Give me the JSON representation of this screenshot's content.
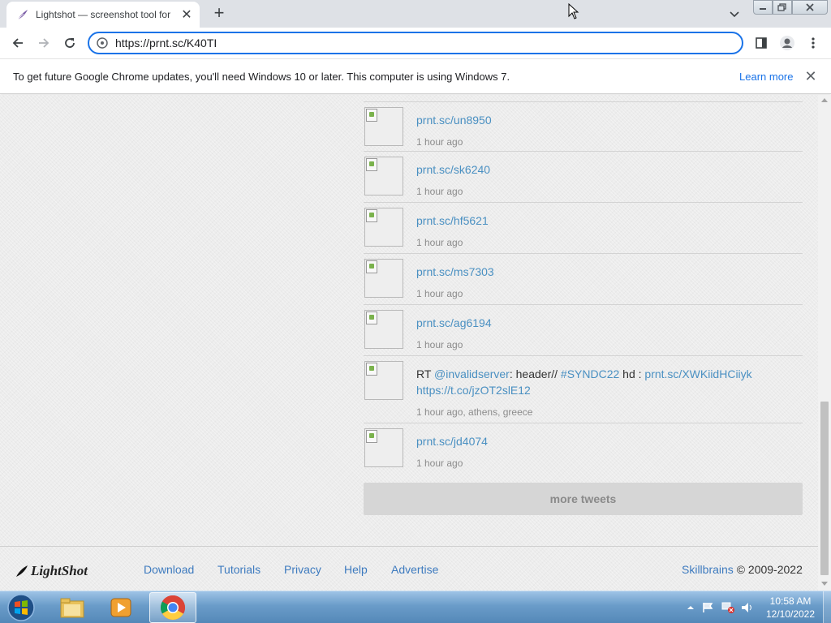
{
  "browser": {
    "tab_title": "Lightshot — screenshot tool for Mac & Win",
    "url": "https://prnt.sc/K40TI",
    "infobar_message": "To get future Google Chrome updates, you'll need Windows 10 or later. This computer is using Windows 7.",
    "infobar_link": "Learn more"
  },
  "feed": {
    "items": [
      {
        "link": "prnt.sc/un8950",
        "time": "1 hour ago"
      },
      {
        "link": "prnt.sc/sk6240",
        "time": "1 hour ago"
      },
      {
        "link": "prnt.sc/hf5621",
        "time": "1 hour ago"
      },
      {
        "link": "prnt.sc/ms7303",
        "time": "1 hour ago"
      },
      {
        "link": "prnt.sc/ag6194",
        "time": "1 hour ago"
      },
      {
        "tweet": {
          "prefix": "RT ",
          "mention": "@invalidserver",
          "text1": ": header// ",
          "hashtag": "#SYNDC22",
          "text2": " hd : ",
          "link1": "prnt.sc/XWKiidHCiiyk",
          "link2": "https://t.co/jzOT2slE12"
        },
        "time": "1 hour ago, athens, greece"
      },
      {
        "link": "prnt.sc/jd4074",
        "time": "1 hour ago"
      }
    ],
    "more_button": "more tweets"
  },
  "footer": {
    "logo": "LightShot",
    "links": [
      "Download",
      "Tutorials",
      "Privacy",
      "Help",
      "Advertise"
    ],
    "company": "Skillbrains",
    "copyright": " © 2009-2022"
  },
  "taskbar": {
    "time": "10:58 AM",
    "date": "12/10/2022",
    "pinned": [
      "windows-explorer-icon",
      "media-player-icon",
      "chrome-icon"
    ]
  },
  "colors": {
    "link": "#4a90c2",
    "footer_link": "#3e7bbf",
    "focus_ring": "#1a73e8"
  }
}
